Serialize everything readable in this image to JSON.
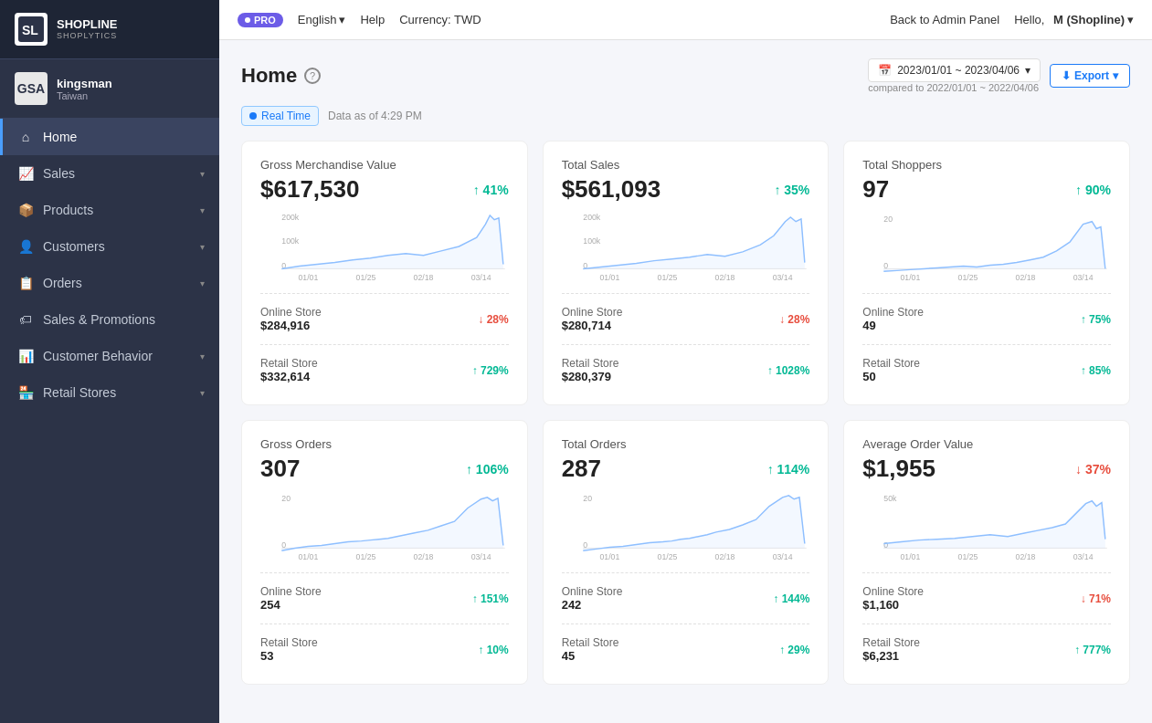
{
  "brand": {
    "name": "SHOPLINE",
    "sub": "SHOPLYTICS",
    "store_initial": "GSA"
  },
  "store": {
    "name": "kingsman",
    "region": "Taiwan"
  },
  "topbar": {
    "pro_label": "PRO",
    "lang": "English",
    "help": "Help",
    "currency": "Currency: TWD",
    "back_admin": "Back to Admin Panel",
    "hello": "Hello,",
    "user": "M (Shopline)"
  },
  "page": {
    "title": "Home",
    "date_range": "2023/01/01 ~ 2023/04/06",
    "date_compare": "compared to 2022/01/01 ~ 2022/04/06",
    "export": "Export",
    "realtime": "Real Time",
    "timestamp": "Data as of 4:29 PM"
  },
  "nav": [
    {
      "id": "home",
      "label": "Home",
      "active": true
    },
    {
      "id": "sales",
      "label": "Sales",
      "has_children": true
    },
    {
      "id": "products",
      "label": "Products",
      "has_children": true
    },
    {
      "id": "customers",
      "label": "Customers",
      "has_children": true
    },
    {
      "id": "orders",
      "label": "Orders",
      "has_children": true
    },
    {
      "id": "sales-promotions",
      "label": "Sales & Promotions",
      "has_children": false
    },
    {
      "id": "customer-behavior",
      "label": "Customer Behavior",
      "has_children": true
    },
    {
      "id": "retail-stores",
      "label": "Retail Stores",
      "has_children": true
    }
  ],
  "cards": [
    {
      "id": "gmv",
      "title": "Gross Merchandise Value",
      "value": "$617,530",
      "pct": "41%",
      "pct_dir": "up",
      "online_label": "Online Store",
      "online_val": "$284,916",
      "online_pct": "28%",
      "online_dir": "down",
      "retail_label": "Retail Store",
      "retail_val": "$332,614",
      "retail_pct": "729%",
      "retail_dir": "up",
      "chart_ymax": "200k",
      "chart_ymid": "100k"
    },
    {
      "id": "total-sales",
      "title": "Total Sales",
      "value": "$561,093",
      "pct": "35%",
      "pct_dir": "up",
      "online_label": "Online Store",
      "online_val": "$280,714",
      "online_pct": "28%",
      "online_dir": "down",
      "retail_label": "Retail Store",
      "retail_val": "$280,379",
      "retail_pct": "1028%",
      "retail_dir": "up",
      "chart_ymax": "200k",
      "chart_ymid": "100k"
    },
    {
      "id": "total-shoppers",
      "title": "Total Shoppers",
      "value": "97",
      "pct": "90%",
      "pct_dir": "up",
      "online_label": "Online Store",
      "online_val": "49",
      "online_pct": "75%",
      "online_dir": "up",
      "retail_label": "Retail Store",
      "retail_val": "50",
      "retail_pct": "85%",
      "retail_dir": "up",
      "chart_ymax": "20",
      "chart_ymid": ""
    },
    {
      "id": "gross-orders",
      "title": "Gross Orders",
      "value": "307",
      "pct": "106%",
      "pct_dir": "up",
      "online_label": "Online Store",
      "online_val": "254",
      "online_pct": "151%",
      "online_dir": "up",
      "retail_label": "Retail Store",
      "retail_val": "53",
      "retail_pct": "10%",
      "retail_dir": "up",
      "chart_ymax": "20",
      "chart_ymid": ""
    },
    {
      "id": "total-orders",
      "title": "Total Orders",
      "value": "287",
      "pct": "114%",
      "pct_dir": "up",
      "online_label": "Online Store",
      "online_val": "242",
      "online_pct": "144%",
      "online_dir": "up",
      "retail_label": "Retail Store",
      "retail_val": "45",
      "retail_pct": "29%",
      "retail_dir": "up",
      "chart_ymax": "20",
      "chart_ymid": ""
    },
    {
      "id": "avg-order-value",
      "title": "Average Order Value",
      "value": "$1,955",
      "pct": "37%",
      "pct_dir": "down",
      "online_label": "Online Store",
      "online_val": "$1,160",
      "online_pct": "71%",
      "online_dir": "down",
      "retail_label": "Retail Store",
      "retail_val": "$6,231",
      "retail_pct": "777%",
      "retail_dir": "up",
      "chart_ymax": "50k",
      "chart_ymid": ""
    }
  ],
  "chart_x_labels": [
    "01/01",
    "01/25",
    "02/18",
    "03/14"
  ]
}
